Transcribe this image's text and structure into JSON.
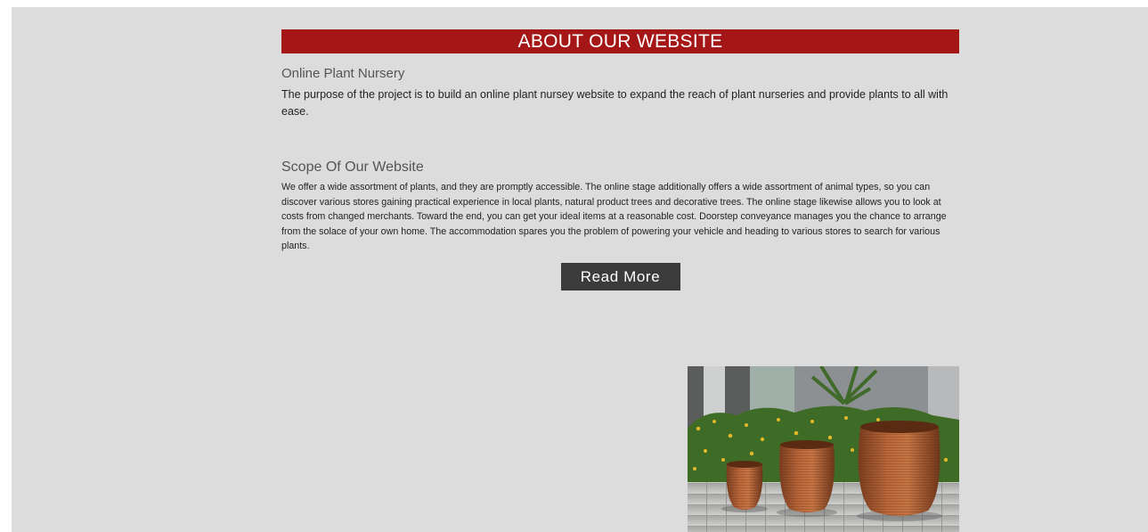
{
  "about": {
    "banner_title": "ABOUT OUR WEBSITE",
    "section1_heading": "Online Plant Nursery",
    "section1_text": "The purpose of the project is to build an online plant nursey website to expand the reach of plant nurseries and provide plants to all with ease.",
    "section2_heading": "Scope Of Our Website",
    "section2_text": "We offer a wide assortment of plants, and they are promptly accessible. The online stage additionally offers a wide assortment of animal types, so you can discover various stores gaining practical experience in local plants, natural product trees and decorative trees. The online stage likewise allows you to look at costs from changed merchants. Toward the end, you can get your ideal items at a reasonable cost. Doorstep conveyance manages you the chance to arrange from the solace of your own home. The accommodation spares you the problem of powering your vehicle and heading to various stores to search for various plants.",
    "read_more_label": "Read More"
  },
  "colors": {
    "banner": "#a51616",
    "page_bg": "#dcdcdc",
    "button_bg": "#3b3b3b"
  },
  "image": {
    "subject": "terracotta-planter-pots-photo"
  }
}
